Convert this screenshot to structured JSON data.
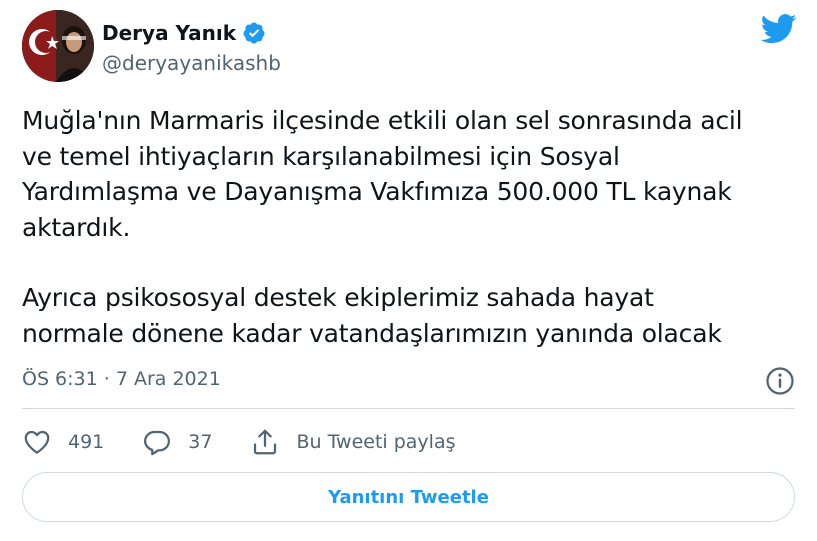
{
  "author": {
    "display_name": "Derya Yanık",
    "handle": "@deryayanikashb",
    "verified": true
  },
  "tweet": {
    "paragraphs": [
      "Muğla'nın Marmaris ilçesinde etkili olan sel sonrasında acil\nve temel ihtiyaçların karşılanabilmesi için Sosyal\nYardımlaşma ve Dayanışma Vakfımıza 500.000 TL kaynak\naktardık.",
      "Ayrıca psikososyal destek ekiplerimiz sahada hayat\nnormale dönene kadar vatandaşlarımızın yanında olacak"
    ],
    "timestamp": "ÖS 6:31 · 7 Ara 2021"
  },
  "actions": {
    "like_count": "491",
    "reply_count": "37",
    "share_label": "Bu Tweeti paylaş"
  },
  "reply_button_label": "Yanıtını Tweetle",
  "colors": {
    "accent": "#1d9bf0",
    "secondary_text": "#536471",
    "border": "#cfd9de"
  }
}
